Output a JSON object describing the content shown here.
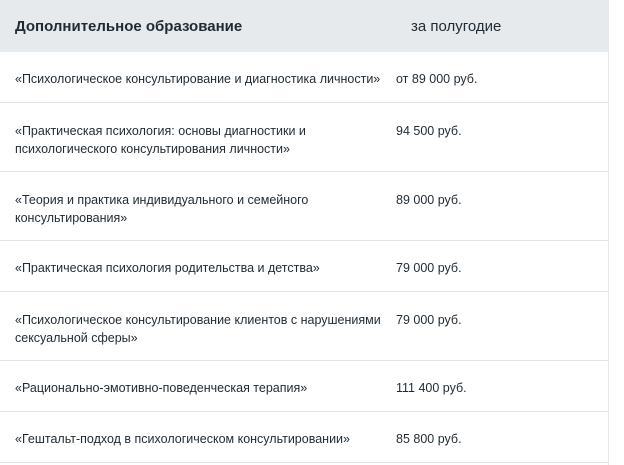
{
  "table": {
    "header": {
      "col1": "Дополнительное образование",
      "col2": "за полугодие"
    },
    "rows": [
      {
        "program": "«Психологическое консультирование и диагностика личности»",
        "price": "от 89 000 руб."
      },
      {
        "program": "«Практическая психология: основы диагностики и психологического консультирования личности»",
        "price": "94 500 руб."
      },
      {
        "program": "«Теория и практика индивидуального и семейного консультирования»",
        "price": "89 000 руб."
      },
      {
        "program": "«Практическая психология родительства и детства»",
        "price": "79 000 руб."
      },
      {
        "program": "«Психологическое консультирование клиентов с нарушениями сексуальной сферы»",
        "price": "79 000 руб."
      },
      {
        "program": "«Рационально-эмотивно-поведенческая терапия»",
        "price": "111 400 руб."
      },
      {
        "program": "«Гештальт-подход в психологическом консультировании»",
        "price": "85 800 руб."
      }
    ]
  }
}
